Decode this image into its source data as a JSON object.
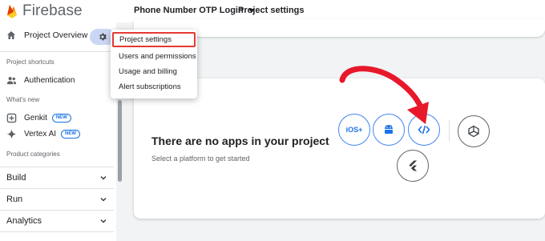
{
  "header": {
    "app_name": "Firebase",
    "project_name": "Phone Number OTP Login",
    "breadcrumb_page": "Project settings"
  },
  "sidebar": {
    "overview_label": "Project Overview",
    "shortcuts_heading": "Project shortcuts",
    "authentication_label": "Authentication",
    "whats_new_heading": "What's new",
    "genkit_label": "Genkit",
    "vertex_label": "Vertex AI",
    "new_badge": "NEW",
    "categories_heading": "Product categories",
    "groups": [
      "Build",
      "Run",
      "Analytics"
    ]
  },
  "settings_menu": {
    "items": [
      "Project settings",
      "Users and permissions",
      "Usage and billing",
      "Alert subscriptions"
    ],
    "highlighted_item": "Project settings"
  },
  "apps_panel": {
    "title": "There are no apps in your project",
    "subtitle": "Select a platform to get started",
    "platforms": [
      {
        "name": "iOS+",
        "icon": "ios-icon"
      },
      {
        "name": "Android",
        "icon": "android-icon"
      },
      {
        "name": "Web",
        "icon": "web-code-icon"
      },
      {
        "name": "Unity",
        "icon": "unity-icon"
      },
      {
        "name": "Flutter",
        "icon": "flutter-icon"
      }
    ]
  },
  "colors": {
    "accent_blue": "#4285f4",
    "menu_highlight_border": "#e53935",
    "annotation_arrow": "#e8182b",
    "firebase_orange": "#ff9100"
  }
}
